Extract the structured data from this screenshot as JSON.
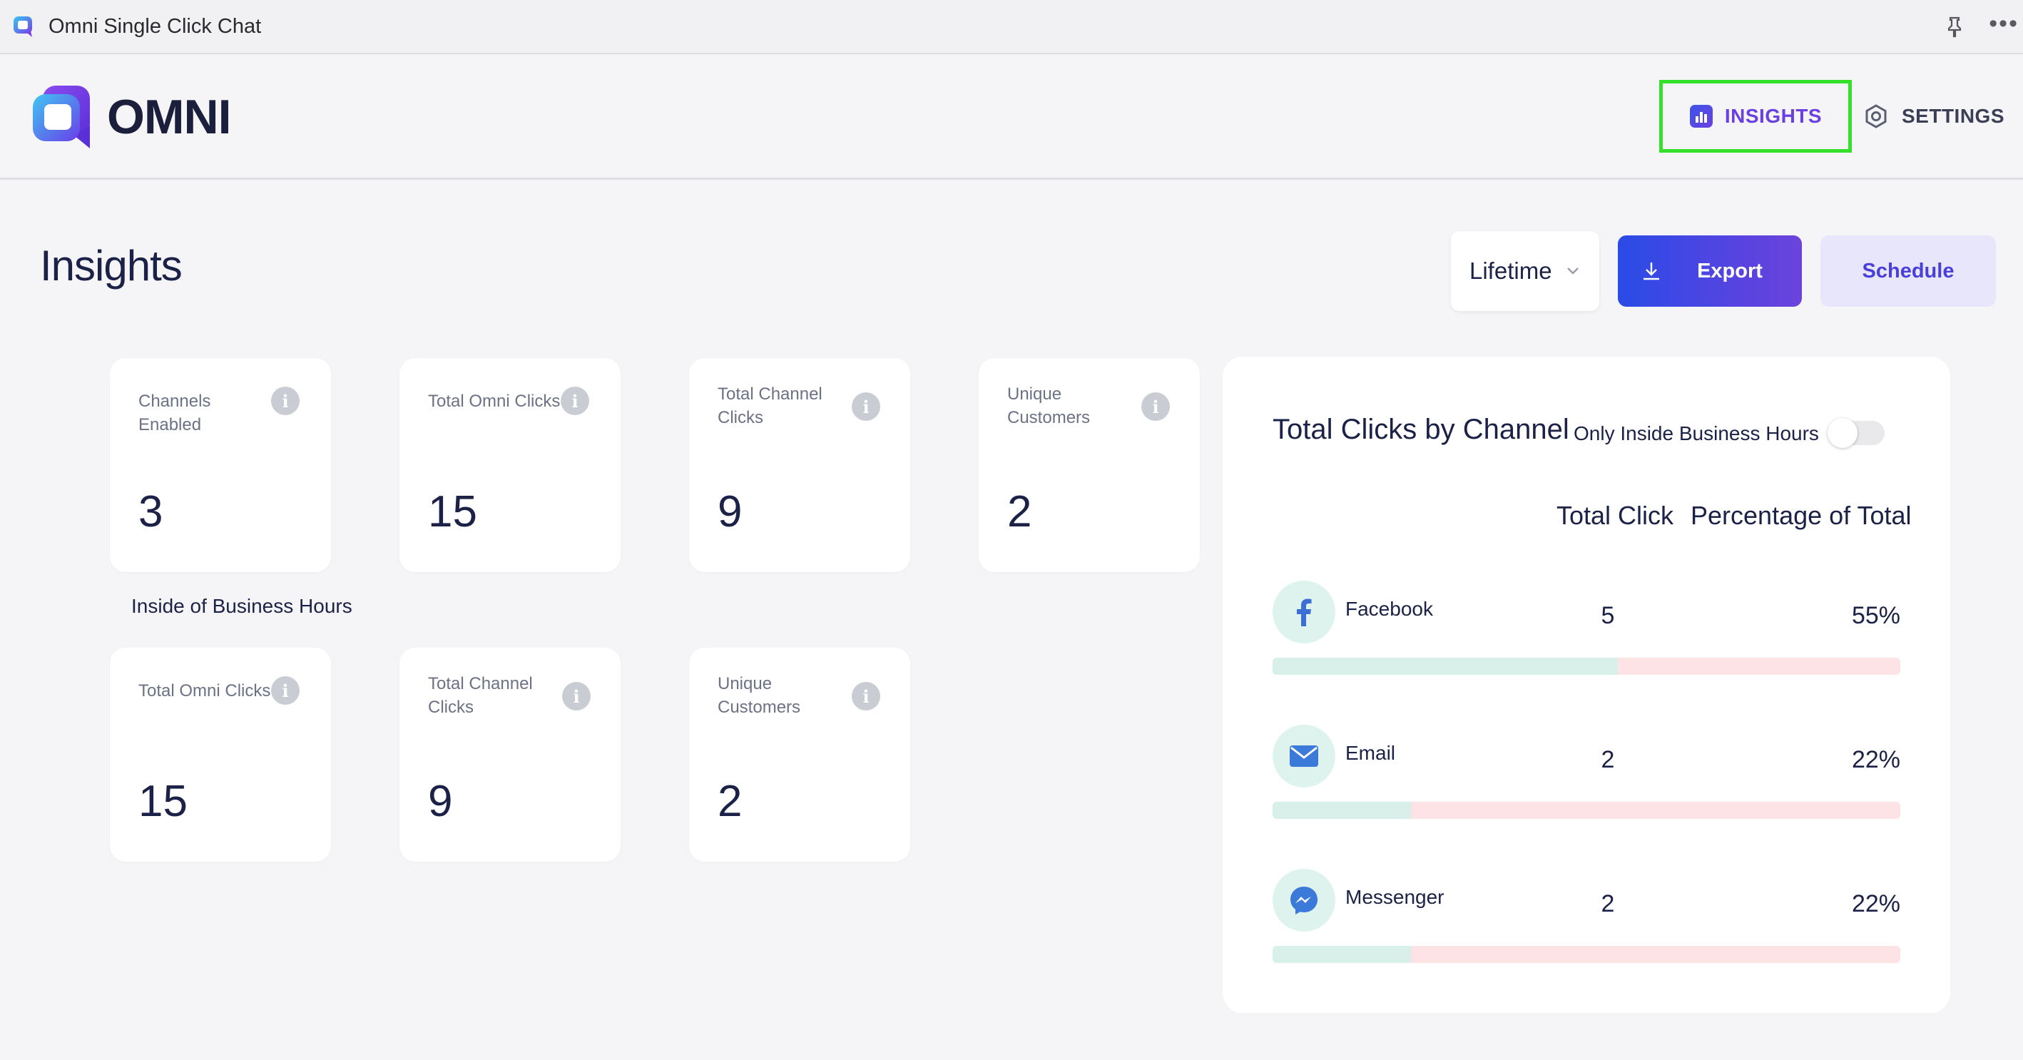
{
  "window": {
    "title": "Omni Single Click Chat",
    "more_label": "•••"
  },
  "header": {
    "logo_text": "OMNI",
    "nav": {
      "insights_label": "INSIGHTS",
      "settings_label": "SETTINGS"
    }
  },
  "page": {
    "title": "Insights",
    "period_select": "Lifetime",
    "export_label": "Export",
    "schedule_label": "Schedule"
  },
  "stats": [
    {
      "label": "Channels Enabled",
      "value": "3"
    },
    {
      "label": "Total Omni Clicks",
      "value": "15"
    },
    {
      "label": "Total Channel Clicks",
      "value": "9"
    },
    {
      "label": "Unique Customers",
      "value": "2"
    }
  ],
  "business_hours": {
    "section_label": "Inside of Business Hours",
    "stats": [
      {
        "label": "Total Omni Clicks",
        "value": "15"
      },
      {
        "label": "Total Channel Clicks",
        "value": "9"
      },
      {
        "label": "Unique Customers",
        "value": "2"
      }
    ]
  },
  "channels_panel": {
    "title": "Total Clicks by Channel",
    "toggle_label": "Only Inside Business Hours",
    "toggle_on": false,
    "col_total": "Total Click",
    "col_percentage": "Percentage of Total",
    "rows": [
      {
        "name": "Facebook",
        "count": "5",
        "percent": "55%",
        "share": 0.55
      },
      {
        "name": "Email",
        "count": "2",
        "percent": "22%",
        "share": 0.22
      },
      {
        "name": "Messenger",
        "count": "2",
        "percent": "22%",
        "share": 0.22
      }
    ]
  },
  "colors": {
    "accent": "#6a40e0",
    "export_gradient_start": "#2a4be6",
    "highlight_border": "#35e02a",
    "bar_fill": "#d9efe9",
    "bar_track": "#fde3e5"
  }
}
